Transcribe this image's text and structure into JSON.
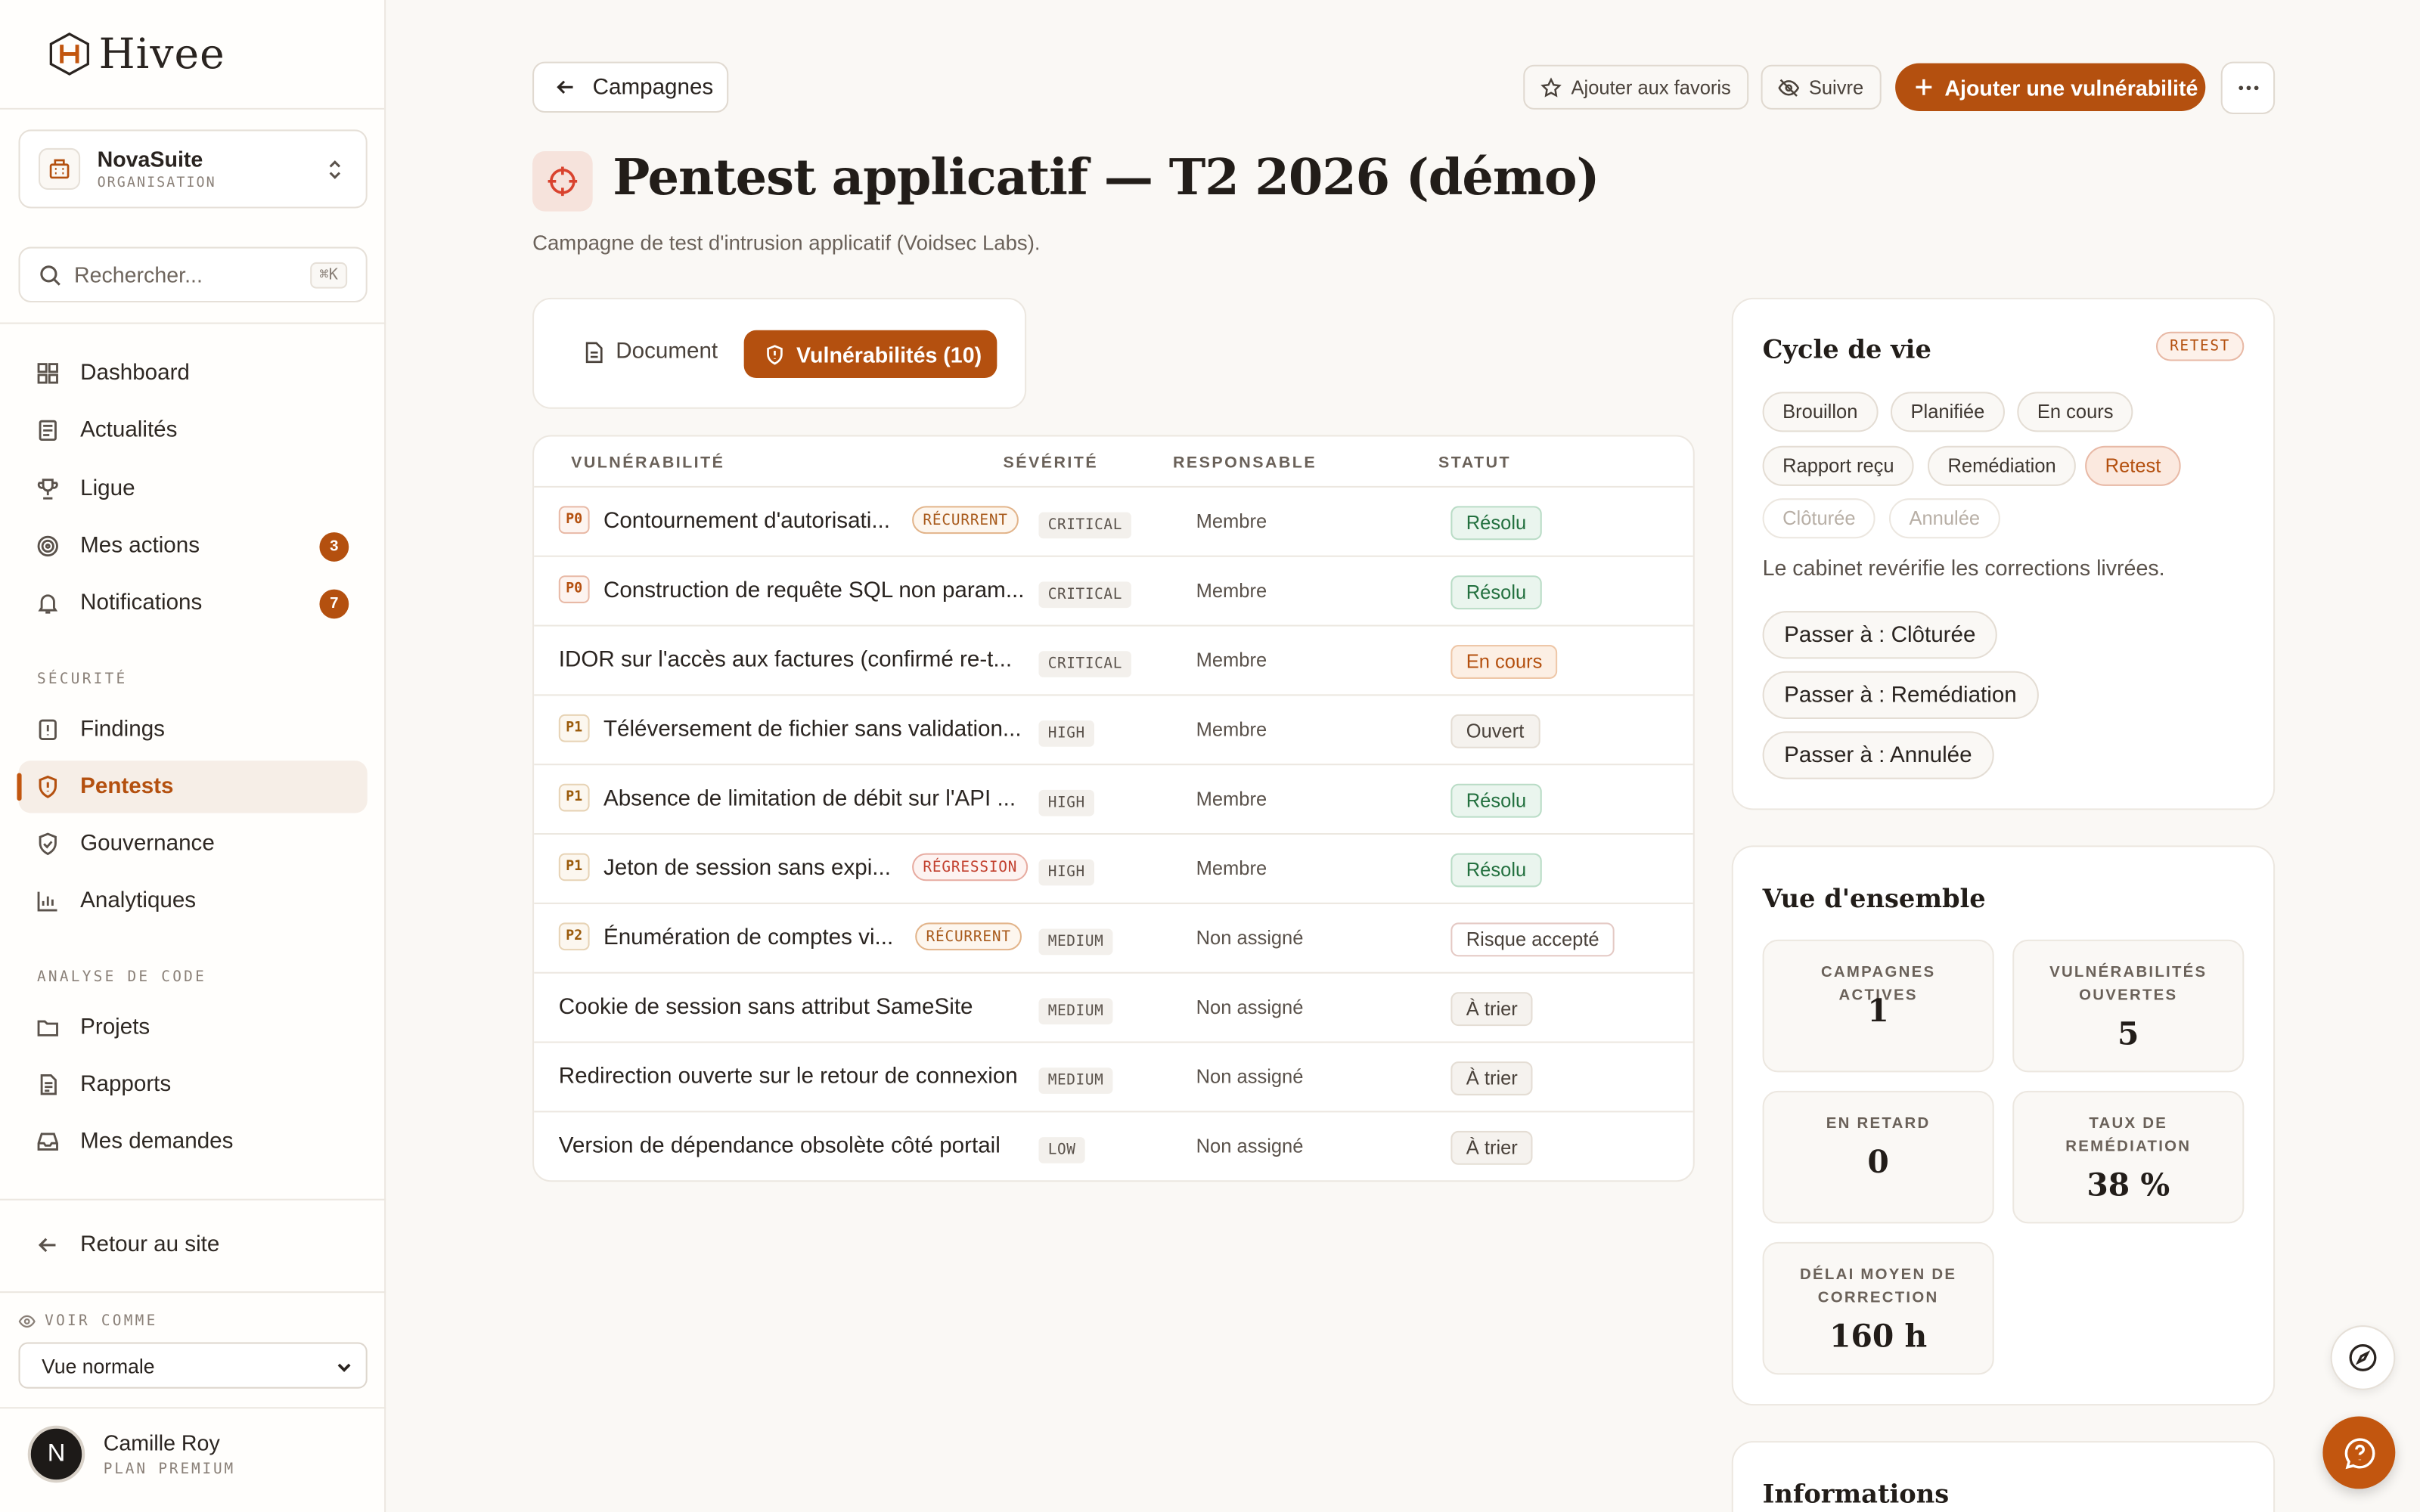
{
  "brand": {
    "name": "Hivee"
  },
  "org": {
    "name": "NovaSuite",
    "type": "ORGANISATION"
  },
  "search": {
    "placeholder": "Rechercher...",
    "shortcut": "⌘K"
  },
  "nav": {
    "main": [
      {
        "label": "Dashboard",
        "icon": "dashboard-icon"
      },
      {
        "label": "Actualités",
        "icon": "newspaper-icon"
      },
      {
        "label": "Ligue",
        "icon": "trophy-icon"
      },
      {
        "label": "Mes actions",
        "icon": "target-icon",
        "count": "3"
      },
      {
        "label": "Notifications",
        "icon": "bell-icon",
        "count": "7"
      }
    ],
    "security_title": "SÉCURITÉ",
    "security": [
      {
        "label": "Findings",
        "icon": "alert-file-icon"
      },
      {
        "label": "Pentests",
        "icon": "shield-alert-icon",
        "active": true
      },
      {
        "label": "Gouvernance",
        "icon": "shield-check-icon"
      },
      {
        "label": "Analytiques",
        "icon": "bar-chart-icon"
      }
    ],
    "code_title": "ANALYSE DE CODE",
    "code": [
      {
        "label": "Projets",
        "icon": "folder-icon"
      },
      {
        "label": "Rapports",
        "icon": "file-text-icon"
      },
      {
        "label": "Mes demandes",
        "icon": "inbox-icon"
      }
    ],
    "back": "Retour au site"
  },
  "view_as": {
    "label": "VOIR COMME",
    "value": "Vue normale"
  },
  "user": {
    "initial": "N",
    "name": "Camille Roy",
    "plan": "PLAN PREMIUM"
  },
  "header": {
    "back": "Campagnes",
    "favorite": "Ajouter aux favoris",
    "follow": "Suivre",
    "add_vuln": "Ajouter une vulnérabilité"
  },
  "page": {
    "title": "Pentest applicatif — T2 2026 (démo)",
    "subtitle": "Campagne de test d'intrusion applicatif (Voidsec Labs)."
  },
  "tabs": {
    "document": "Document",
    "vulns": "Vulnérabilités (10)"
  },
  "table": {
    "headers": {
      "vuln": "VULNÉRABILITÉ",
      "severity": "SÉVÉRITÉ",
      "owner": "RESPONSABLE",
      "status": "STATUT"
    },
    "rows": [
      {
        "prio": "P0",
        "name": "Contournement d'autorisati...",
        "tag": "RÉCURRENT",
        "tag_kind": "rec",
        "severity": "CRITICAL",
        "owner": "Membre",
        "status": "Résolu",
        "status_kind": "resolved"
      },
      {
        "prio": "P0",
        "name": "Construction de requête SQL non param...",
        "tag": "",
        "tag_kind": "",
        "severity": "CRITICAL",
        "owner": "Membre",
        "status": "Résolu",
        "status_kind": "resolved"
      },
      {
        "prio": "",
        "name": "IDOR sur l'accès aux factures (confirmé re-t...",
        "tag": "",
        "tag_kind": "",
        "severity": "CRITICAL",
        "owner": "Membre",
        "status": "En cours",
        "status_kind": "progress"
      },
      {
        "prio": "P1",
        "name": "Téléversement de fichier sans validation...",
        "tag": "",
        "tag_kind": "",
        "severity": "HIGH",
        "owner": "Membre",
        "status": "Ouvert",
        "status_kind": "open"
      },
      {
        "prio": "P1",
        "name": "Absence de limitation de débit sur l'API ...",
        "tag": "",
        "tag_kind": "",
        "severity": "HIGH",
        "owner": "Membre",
        "status": "Résolu",
        "status_kind": "resolved"
      },
      {
        "prio": "P1",
        "name": "Jeton de session sans expi...",
        "tag": "RÉGRESSION",
        "tag_kind": "reg",
        "severity": "HIGH",
        "owner": "Membre",
        "status": "Résolu",
        "status_kind": "resolved"
      },
      {
        "prio": "P2",
        "name": "Énumération de comptes vi...",
        "tag": "RÉCURRENT",
        "tag_kind": "rec",
        "severity": "MEDIUM",
        "owner": "Non assigné",
        "status": "Risque accepté",
        "status_kind": "risk"
      },
      {
        "prio": "",
        "name": "Cookie de session sans attribut SameSite",
        "tag": "",
        "tag_kind": "",
        "severity": "MEDIUM",
        "owner": "Non assigné",
        "status": "À trier",
        "status_kind": "triage"
      },
      {
        "prio": "",
        "name": "Redirection ouverte sur le retour de connexion",
        "tag": "",
        "tag_kind": "",
        "severity": "MEDIUM",
        "owner": "Non assigné",
        "status": "À trier",
        "status_kind": "triage"
      },
      {
        "prio": "",
        "name": "Version de dépendance obsolète côté portail",
        "tag": "",
        "tag_kind": "",
        "severity": "LOW",
        "owner": "Non assigné",
        "status": "À trier",
        "status_kind": "triage"
      }
    ]
  },
  "lifecycle": {
    "title": "Cycle de vie",
    "badge": "RETEST",
    "stages": [
      {
        "label": "Brouillon",
        "state": "done"
      },
      {
        "label": "Planifiée",
        "state": "done"
      },
      {
        "label": "En cours",
        "state": "done"
      },
      {
        "label": "Rapport reçu",
        "state": "done"
      },
      {
        "label": "Remédiation",
        "state": "done"
      },
      {
        "label": "Retest",
        "state": "current"
      },
      {
        "label": "Clôturée",
        "state": "future"
      },
      {
        "label": "Annulée",
        "state": "future"
      }
    ],
    "description": "Le cabinet revérifie les corrections livrées.",
    "actions": [
      "Passer à : Clôturée",
      "Passer à : Remédiation",
      "Passer à : Annulée"
    ]
  },
  "overview": {
    "title": "Vue d'ensemble",
    "stats": [
      {
        "label": "CAMPAGNES ACTIVES",
        "value": "1"
      },
      {
        "label": "VULNÉRABILITÉS OUVERTES",
        "value": "5"
      },
      {
        "label": "EN RETARD",
        "value": "0"
      },
      {
        "label": "TAUX DE REMÉDIATION",
        "value": "38 %"
      },
      {
        "label": "DÉLAI MOYEN DE CORRECTION",
        "value": "160 h"
      }
    ]
  },
  "info": {
    "title": "Informations"
  },
  "colors": {
    "accent": "#b4500f",
    "resolved": "#23703f",
    "background": "#faf8f5"
  }
}
